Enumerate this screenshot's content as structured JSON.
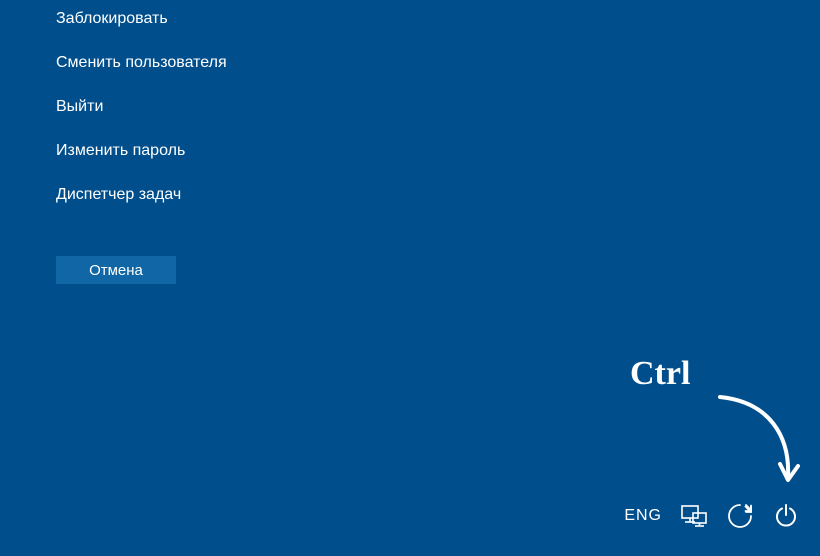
{
  "menu": {
    "items": [
      {
        "label": "Заблокировать"
      },
      {
        "label": "Сменить пользователя"
      },
      {
        "label": "Выйти"
      },
      {
        "label": "Изменить пароль"
      },
      {
        "label": "Диспетчер задач"
      }
    ],
    "cancel_label": "Отмена"
  },
  "annotation": {
    "text": "Ctrl"
  },
  "taskbar": {
    "language": "ENG",
    "icons": {
      "network": "network-icon",
      "ease_of_access": "ease-of-access-icon",
      "power": "power-icon"
    }
  }
}
